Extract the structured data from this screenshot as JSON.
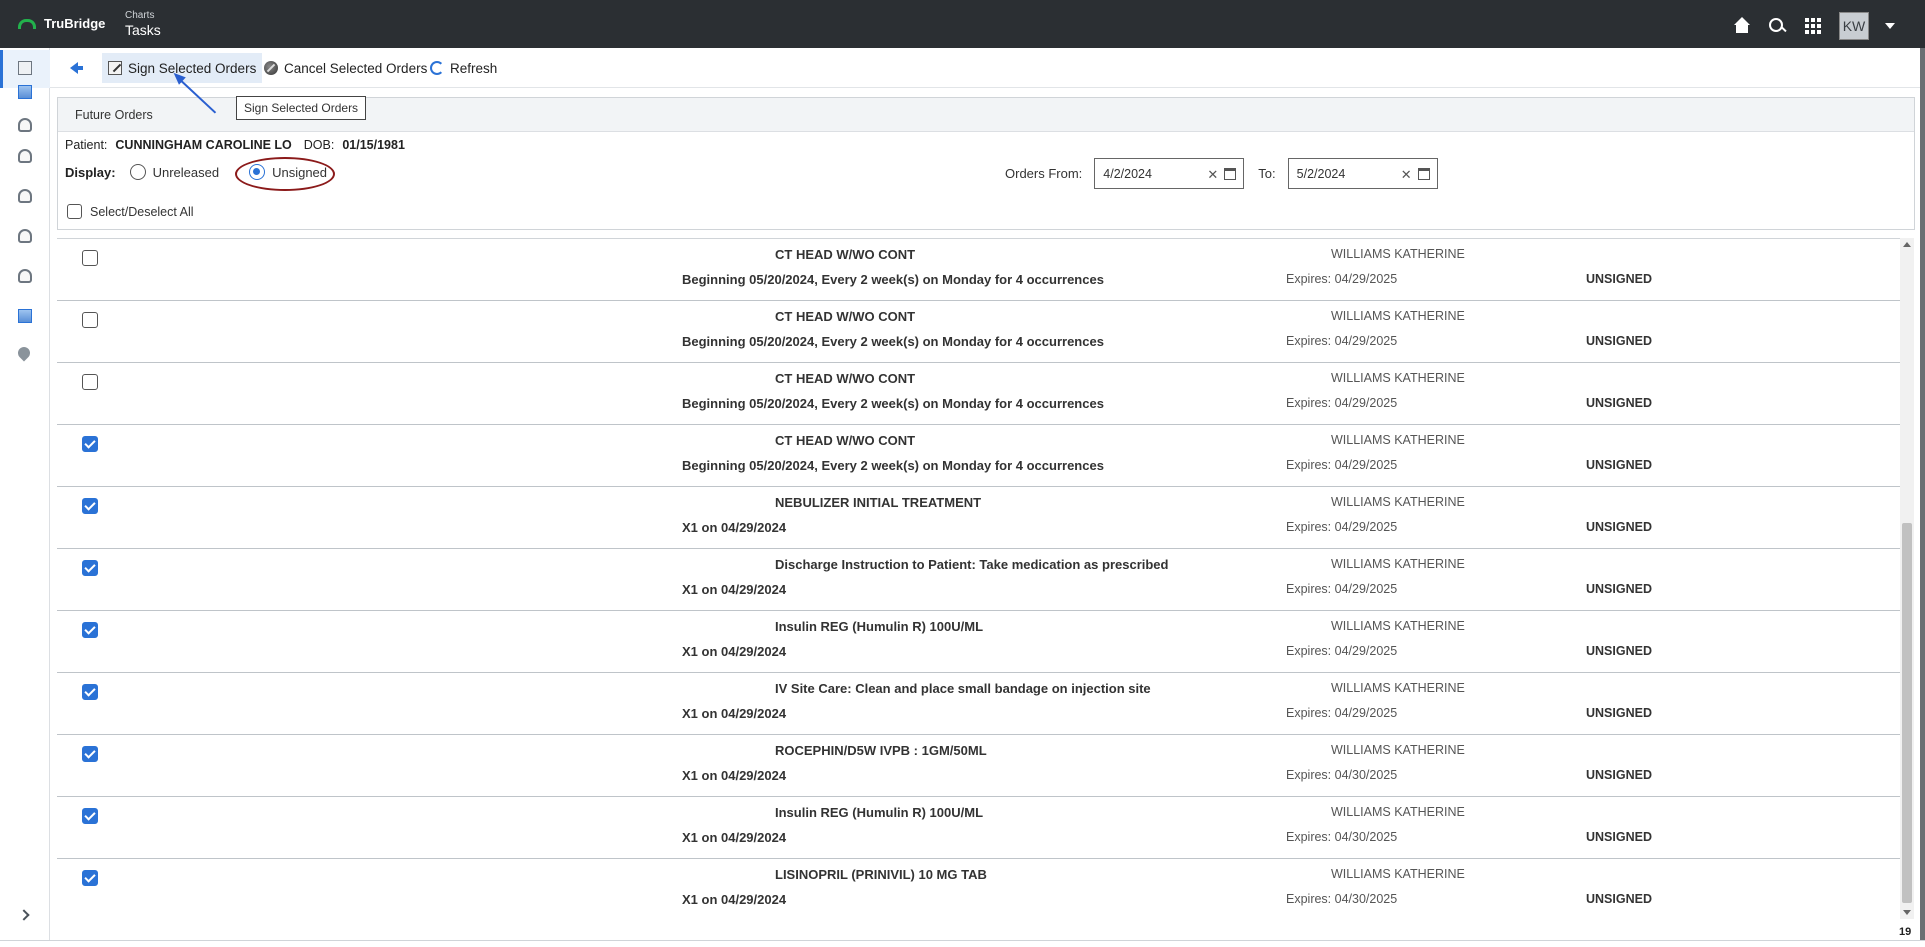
{
  "app": {
    "logo_text": "TruBridge",
    "breadcrumb_parent": "Charts",
    "page_title": "Tasks",
    "user_initials": "KW"
  },
  "toolbar": {
    "sign_label": "Sign Selected Orders",
    "cancel_label": "Cancel Selected Orders",
    "refresh_label": "Refresh"
  },
  "tooltip": "Sign Selected Orders",
  "panel": {
    "title": "Future Orders",
    "patient_label": "Patient:",
    "patient_name": "CUNNINGHAM CAROLINE LO",
    "dob_label": "DOB:",
    "dob_value": "01/15/1981",
    "display_label": "Display:",
    "option_unreleased": "Unreleased",
    "option_unsigned": "Unsigned",
    "selected_option": "Unsigned",
    "orders_from_label": "Orders From:",
    "orders_from_value": "4/2/2024",
    "to_label": "To:",
    "to_value": "5/2/2024",
    "select_all_label": "Select/Deselect All"
  },
  "orders": [
    {
      "checked": false,
      "name": "CT HEAD W/WO CONT",
      "frequency": "Beginning 05/20/2024, Every 2 week(s) on Monday for 4 occurrences",
      "provider": "WILLIAMS KATHERINE",
      "expires": "Expires: 04/29/2025",
      "status": "UNSIGNED"
    },
    {
      "checked": false,
      "name": "CT HEAD W/WO CONT",
      "frequency": "Beginning 05/20/2024, Every 2 week(s) on Monday for 4 occurrences",
      "provider": "WILLIAMS KATHERINE",
      "expires": "Expires: 04/29/2025",
      "status": "UNSIGNED"
    },
    {
      "checked": false,
      "name": "CT HEAD W/WO CONT",
      "frequency": "Beginning 05/20/2024, Every 2 week(s) on Monday for 4 occurrences",
      "provider": "WILLIAMS KATHERINE",
      "expires": "Expires: 04/29/2025",
      "status": "UNSIGNED"
    },
    {
      "checked": true,
      "name": "CT HEAD W/WO CONT",
      "frequency": "Beginning 05/20/2024, Every 2 week(s) on Monday for 4 occurrences",
      "provider": "WILLIAMS KATHERINE",
      "expires": "Expires: 04/29/2025",
      "status": "UNSIGNED"
    },
    {
      "checked": true,
      "name": "NEBULIZER INITIAL TREATMENT",
      "frequency": "X1 on 04/29/2024",
      "provider": "WILLIAMS KATHERINE",
      "expires": "Expires: 04/29/2025",
      "status": "UNSIGNED"
    },
    {
      "checked": true,
      "name": "Discharge Instruction to Patient: Take medication as prescribed",
      "frequency": "X1 on 04/29/2024",
      "provider": "WILLIAMS KATHERINE",
      "expires": "Expires: 04/29/2025",
      "status": "UNSIGNED"
    },
    {
      "checked": true,
      "name": "Insulin REG (Humulin R) 100U/ML",
      "frequency": "X1 on 04/29/2024",
      "provider": "WILLIAMS KATHERINE",
      "expires": "Expires: 04/29/2025",
      "status": "UNSIGNED"
    },
    {
      "checked": true,
      "name": "IV Site Care: Clean and place small bandage on injection site",
      "frequency": "X1 on 04/29/2024",
      "provider": "WILLIAMS KATHERINE",
      "expires": "Expires: 04/29/2025",
      "status": "UNSIGNED"
    },
    {
      "checked": true,
      "name": "ROCEPHIN/D5W IVPB : 1GM/50ML",
      "frequency": "X1 on 04/29/2024",
      "provider": "WILLIAMS KATHERINE",
      "expires": "Expires: 04/30/2025",
      "status": "UNSIGNED"
    },
    {
      "checked": true,
      "name": "Insulin REG (Humulin R) 100U/ML",
      "frequency": "X1 on 04/29/2024",
      "provider": "WILLIAMS KATHERINE",
      "expires": "Expires: 04/30/2025",
      "status": "UNSIGNED"
    },
    {
      "checked": true,
      "name": "LISINOPRIL (PRINIVIL) 10 MG TAB",
      "frequency": "X1 on 04/29/2024",
      "provider": "WILLIAMS KATHERINE",
      "expires": "Expires: 04/30/2025",
      "status": "UNSIGNED"
    }
  ],
  "page_number": "19",
  "icons": {
    "top": [
      "home-icon",
      "search-icon",
      "apps-grid-icon",
      "caret-down-icon"
    ],
    "sidebar": [
      "document-icon",
      "image-icon",
      "person-icon",
      "person-icon",
      "person-icon",
      "person-icon",
      "person-icon",
      "image-icon",
      "pin-icon"
    ]
  },
  "colors": {
    "topbar": "#2b2f33",
    "accent": "#2a72d6",
    "highlight_ellipse": "#8b1a1a",
    "logo_green": "#22b14c"
  }
}
